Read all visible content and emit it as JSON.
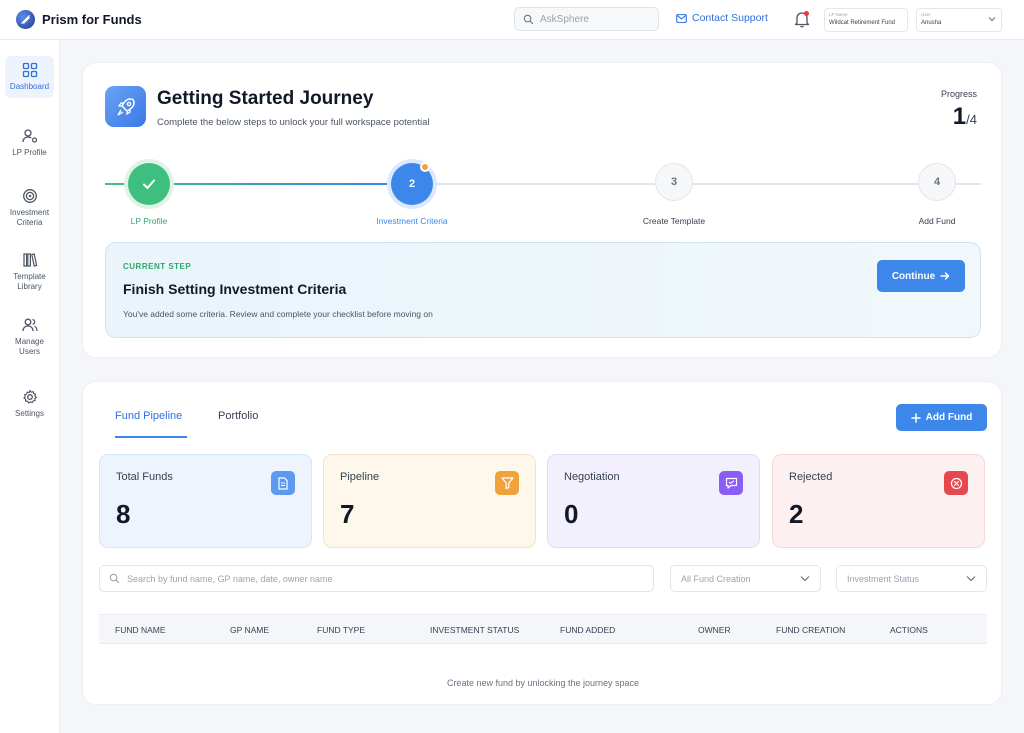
{
  "header": {
    "brand": "Prism for Funds",
    "search_placeholder": "AskSphere",
    "contact": "Contact Support",
    "lp_label": "LP Name",
    "lp_value": "Wildcat Retirement Fund",
    "user_label": "User",
    "user_value": "Anusha"
  },
  "sidebar": {
    "items": [
      {
        "label": "Dashboard",
        "icon": "grid-icon"
      },
      {
        "label": "LP Profile",
        "icon": "user-settings-icon"
      },
      {
        "label": "Investment Criteria",
        "icon": "target-icon"
      },
      {
        "label": "Template Library",
        "icon": "books-icon"
      },
      {
        "label": "Manage Users",
        "icon": "users-icon"
      },
      {
        "label": "Settings",
        "icon": "gear-icon"
      }
    ]
  },
  "journey": {
    "title": "Getting Started Journey",
    "subtitle": "Complete the below steps to unlock your full workspace potential",
    "progress_label": "Progress",
    "progress_current": "1",
    "progress_total": "/4",
    "progress_fraction": 0.33,
    "steps": [
      {
        "number": "",
        "label": "LP Profile",
        "state": "done"
      },
      {
        "number": "2",
        "label": "Investment Criteria",
        "state": "current"
      },
      {
        "number": "3",
        "label": "Create Template",
        "state": "todo"
      },
      {
        "number": "4",
        "label": "Add Fund",
        "state": "todo"
      }
    ],
    "current_step": {
      "tag": "CURRENT STEP",
      "title": "Finish Setting Investment Criteria",
      "description": "You've added some criteria. Review and complete your checklist before moving on",
      "button": "Continue"
    }
  },
  "pipeline": {
    "tabs": [
      "Fund Pipeline",
      "Portfolio"
    ],
    "add_button": "Add Fund",
    "stats": [
      {
        "label": "Total Funds",
        "value": "8",
        "icon": "document-icon",
        "accent": "#5b9af0",
        "bg": "#eef4fd",
        "border": "#d7e5f8"
      },
      {
        "label": "Pipeline",
        "value": "7",
        "icon": "filter-icon",
        "accent": "#f0a23b",
        "bg": "#fdf8ea",
        "border": "#f2e6c4"
      },
      {
        "label": "Negotiation",
        "value": "0",
        "icon": "chat-handshake-icon",
        "accent": "#8b5cf6",
        "bg": "#f3f0fd",
        "border": "#e2dbf7"
      },
      {
        "label": "Rejected",
        "value": "2",
        "icon": "close-circle-icon",
        "accent": "#e5484d",
        "bg": "#fdf0f0",
        "border": "#f5d9d9"
      }
    ],
    "search_placeholder": "Search by fund name, GP name, date, owner name",
    "filters": [
      "All Fund Creation",
      "Investment Status"
    ],
    "columns": [
      "FUND NAME",
      "GP NAME",
      "FUND TYPE",
      "INVESTMENT STATUS",
      "FUND ADDED",
      "OWNER",
      "FUND CREATION",
      "ACTIONS"
    ],
    "empty_message": "Create new fund by unlocking the journey space"
  },
  "colors": {
    "accent": "#3d86ea",
    "success": "#3fbf7f",
    "warning": "#f0a23b"
  }
}
